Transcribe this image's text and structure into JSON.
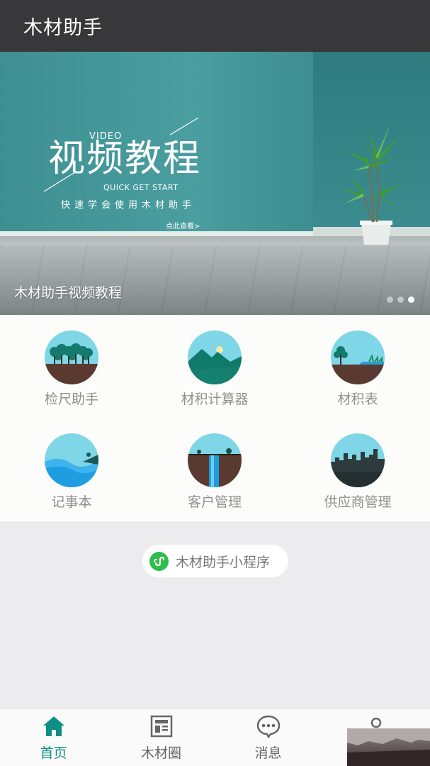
{
  "header": {
    "title": "木材助手"
  },
  "banner": {
    "headline": "视频教程",
    "video_tag": "VIDEO",
    "subtitle_en": "QUICK GET START",
    "subtitle_cn": "快速学会使用木材助手",
    "link": "点此查看>",
    "caption": "木材助手视频教程",
    "slides": 3,
    "active_slide": 3
  },
  "features": [
    {
      "label": "检尺助手",
      "icon": "forest-icon"
    },
    {
      "label": "材积计算器",
      "icon": "mountain-icon"
    },
    {
      "label": "材积表",
      "icon": "lone-tree-icon"
    },
    {
      "label": "记事本",
      "icon": "lake-icon"
    },
    {
      "label": "客户管理",
      "icon": "waterfall-icon"
    },
    {
      "label": "供应商管理",
      "icon": "city-icon"
    }
  ],
  "mini_program": {
    "label": "木材助手小程序",
    "icon": "mini-program-icon"
  },
  "nav": {
    "items": [
      {
        "label": "首页",
        "icon": "home-icon",
        "active": true
      },
      {
        "label": "木材圈",
        "icon": "feed-icon",
        "active": false
      },
      {
        "label": "消息",
        "icon": "chat-icon",
        "active": false
      },
      {
        "label": "",
        "icon": "user-icon",
        "active": false
      }
    ]
  },
  "colors": {
    "header_bg": "#38383a",
    "accent": "#0e8f84",
    "banner_teal": "#3e8f92",
    "icon_sky": "#7ed6e6",
    "mini_green": "#2dbd4a"
  }
}
